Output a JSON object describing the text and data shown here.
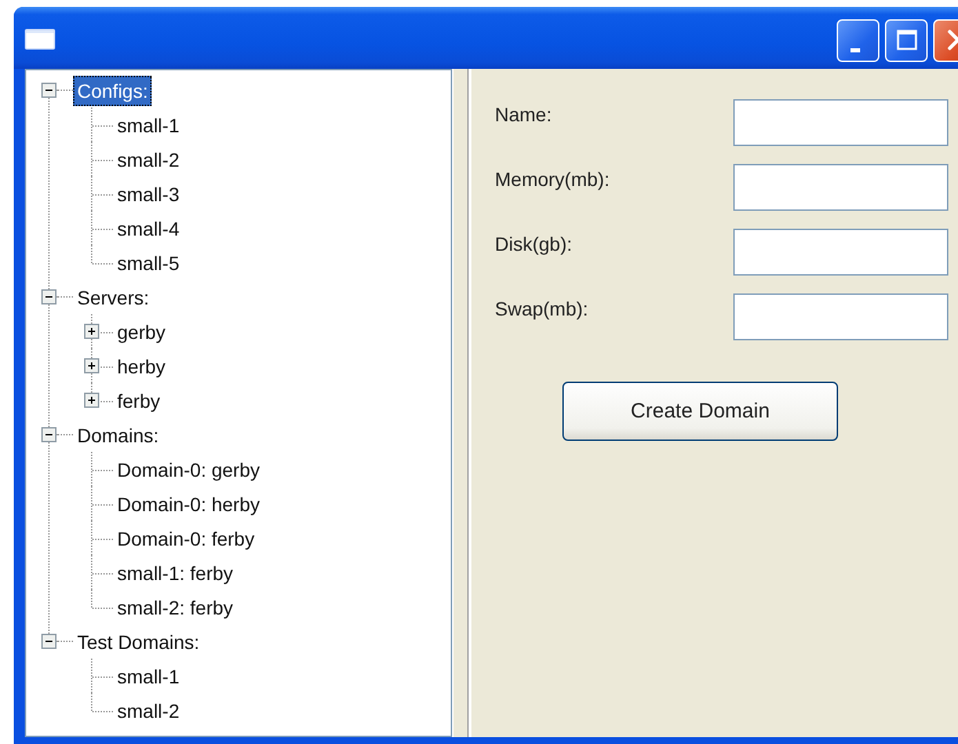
{
  "window": {
    "controls": [
      {
        "kind": "minimize"
      },
      {
        "kind": "maximize"
      },
      {
        "kind": "close"
      }
    ]
  },
  "tree": [
    {
      "label": "Configs:",
      "expanded": true,
      "selected": true,
      "children": [
        {
          "label": "small-1",
          "selected": false
        },
        {
          "label": "small-2",
          "selected": false
        },
        {
          "label": "small-3",
          "selected": false
        },
        {
          "label": "small-4",
          "selected": false
        },
        {
          "label": "small-5",
          "selected": false
        }
      ]
    },
    {
      "label": "Servers:",
      "expanded": true,
      "selected": false,
      "children": [
        {
          "label": "gerby",
          "expanded": false,
          "selected": false
        },
        {
          "label": "herby",
          "expanded": false,
          "selected": false
        },
        {
          "label": "ferby",
          "expanded": false,
          "selected": false
        }
      ]
    },
    {
      "label": "Domains:",
      "expanded": true,
      "selected": false,
      "children": [
        {
          "label": "Domain-0: gerby",
          "selected": false
        },
        {
          "label": "Domain-0: herby",
          "selected": false
        },
        {
          "label": "Domain-0: ferby",
          "selected": false
        },
        {
          "label": "small-1: ferby",
          "selected": false
        },
        {
          "label": "small-2: ferby",
          "selected": false
        }
      ]
    },
    {
      "label": "Test Domains:",
      "expanded": true,
      "selected": false,
      "children": [
        {
          "label": "small-1",
          "selected": false
        },
        {
          "label": "small-2",
          "selected": false
        }
      ]
    }
  ],
  "form": {
    "fields": [
      {
        "label": "Name:"
      },
      {
        "label": "Memory(mb):"
      },
      {
        "label": "Disk(gb):"
      },
      {
        "label": "Swap(mb):"
      }
    ],
    "button": "Create Domain"
  }
}
